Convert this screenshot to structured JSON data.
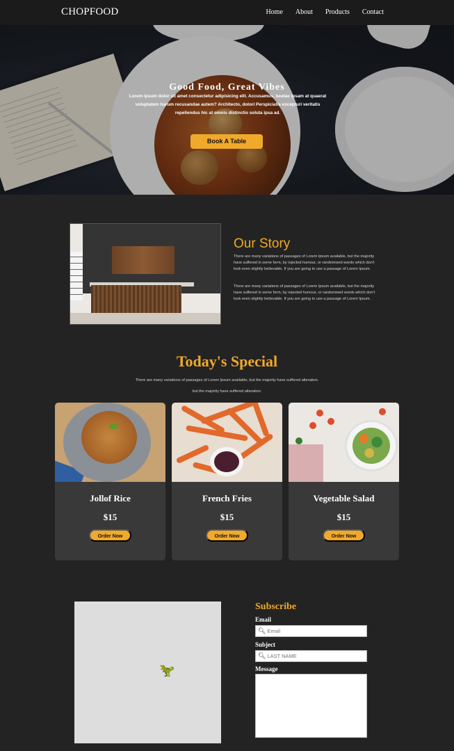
{
  "nav": {
    "brand": "CHOPFOOD",
    "links": [
      "Home",
      "About",
      "Products",
      "Contact"
    ]
  },
  "hero": {
    "title": "Good Food, Great Vibes",
    "text": "Lorem ipsum dolor sit amet consectetur adipisicing elit. Accusamus, beatae ipsam at quaerat voluptatem harum recusandae autem? Architecto, dolori Perspiciatis excepturi veritatis repellendus hic at omnis distinctio soluta ipsa ad.",
    "cta": "Book A Table"
  },
  "story": {
    "title": "Our Story",
    "paragraphs": [
      "There are many variations of passages of Lorem Ipsum available, but the majority have suffered in some form, by injected humour, or randomised words which don't look even slightly believable. If you are going to use a passage of Lorem Ipsum.",
      "There are many variations of passages of Lorem Ipsum available, but the majority have suffered in some form, by rejected humour, or randomised words which don't look even slightly believable. If you are going to use a passage of Lorem Ipsum."
    ]
  },
  "special": {
    "title": "Today's Special",
    "sub1": "There are many variations of passages of Lorem Ipsum available, but the majority have suffered alteration.",
    "sub2": "but the majority have suffered alteration.",
    "items": [
      {
        "name": "Jollof Rice",
        "price": "$15",
        "button": "Order Now"
      },
      {
        "name": "French Fries",
        "price": "$15",
        "button": "Order Now"
      },
      {
        "name": "Vegetable Salad",
        "price": "$15",
        "button": "Order Now"
      }
    ]
  },
  "subscribe": {
    "title": "Subscribe",
    "email_label": "Email",
    "email_placeholder": "Email",
    "subject_label": "Subject",
    "subject_placeholder": "LAST NAME",
    "message_label": "Message",
    "search_icon": "search-icon"
  },
  "colors": {
    "accent": "#f1a92b",
    "background": "#232323",
    "card": "#393939",
    "nav": "#1b1b1b"
  }
}
